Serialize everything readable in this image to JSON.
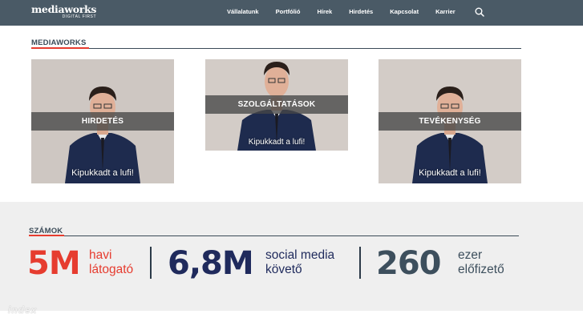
{
  "brand": {
    "name": "mediaworks",
    "tagline": "DIGITAL FIRST"
  },
  "nav": {
    "items": [
      "Vállalatunk",
      "Portfólió",
      "Hírek",
      "Hirdetés",
      "Kapcsolat",
      "Karrier"
    ],
    "search_icon": "search-icon"
  },
  "section_mediaworks": {
    "title": "MEDIAWORKS",
    "cards": [
      {
        "label": "HIRDETÉS",
        "caption": "Kipukkadt a lufi!"
      },
      {
        "label": "SZOLGÁLTATÁSOK",
        "caption": "Kipukkadt a lufi!"
      },
      {
        "label": "TEVÉKENYSÉG",
        "caption": "Kipukkadt a lufi!"
      }
    ]
  },
  "section_numbers": {
    "title": "SZÁMOK",
    "stats": [
      {
        "value": "5M",
        "line1": "havi",
        "line2": "látogató"
      },
      {
        "value": "6,8M",
        "line1": "social media",
        "line2": "követő"
      },
      {
        "value": "260",
        "line1": "ezer",
        "line2": "előfizető"
      }
    ]
  },
  "watermark": "index",
  "colors": {
    "nav_bg": "#4a5a66",
    "accent": "#e63c2f",
    "navy": "#1f2a5c",
    "slate": "#3d4f5d"
  }
}
